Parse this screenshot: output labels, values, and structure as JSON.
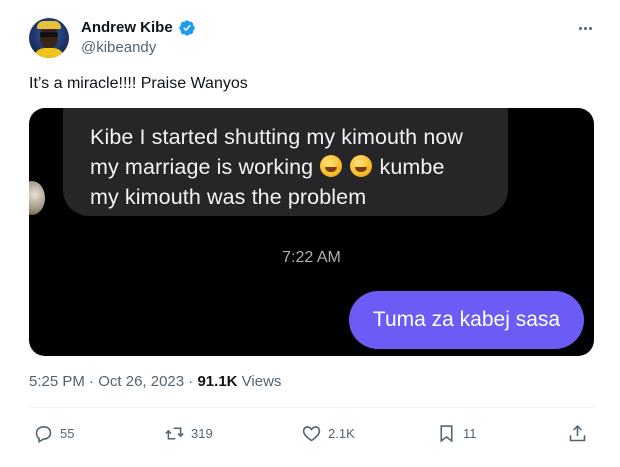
{
  "author": {
    "display_name": "Andrew Kibe",
    "handle": "@kibeandy"
  },
  "tweet": {
    "text": "It’s a miracle!!!! Praise Wanyos"
  },
  "media": {
    "incoming_line1": "Kibe I started shutting my kimouth now",
    "incoming_line2_a": "my marriage is working",
    "incoming_line2_b": "kumbe",
    "incoming_line3": "my kimouth was the problem",
    "time": "7:22 AM",
    "outgoing": "Tuma za kabej sasa"
  },
  "meta": {
    "time": "5:25 PM",
    "separator1": "·",
    "date": "Oct 26, 2023",
    "separator2": "·",
    "views_count": "91.1K",
    "views_label": "Views"
  },
  "actions": {
    "replies": "55",
    "reposts": "319",
    "likes": "2.1K",
    "bookmarks": "11"
  },
  "colors": {
    "verified": "#1d9bf0",
    "outgoing_bubble": "#6a5cf5",
    "incoming_bubble": "#262628"
  }
}
